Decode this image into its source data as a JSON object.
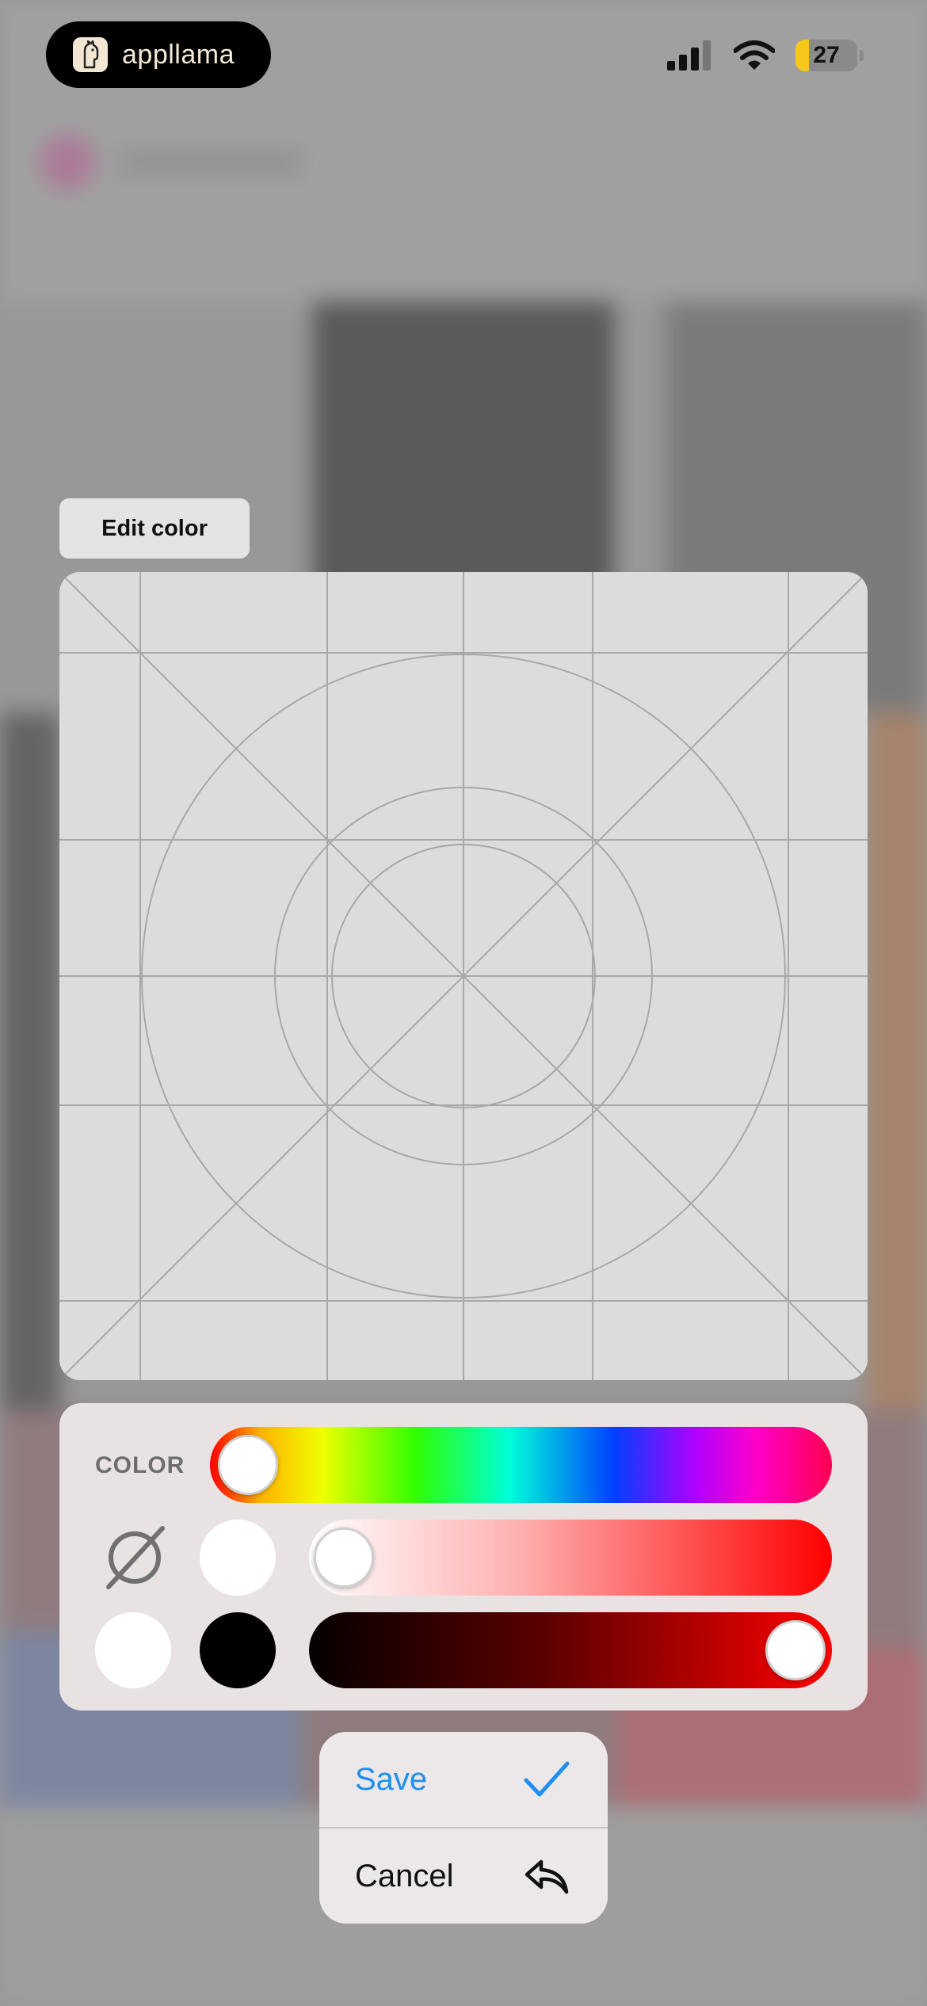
{
  "status_bar": {
    "brand": "appllama",
    "battery_level": "27"
  },
  "editor": {
    "title": "Edit color",
    "color_label": "COLOR",
    "hue_value": 0,
    "saturation_value": 0,
    "brightness_value": 1,
    "swatches": [
      "#ffffff",
      "#000000",
      "#ffffff"
    ]
  },
  "menu": {
    "save_label": "Save",
    "cancel_label": "Cancel"
  },
  "colors": {
    "accent": "#1e8ff0",
    "battery": "#f7c61b"
  }
}
